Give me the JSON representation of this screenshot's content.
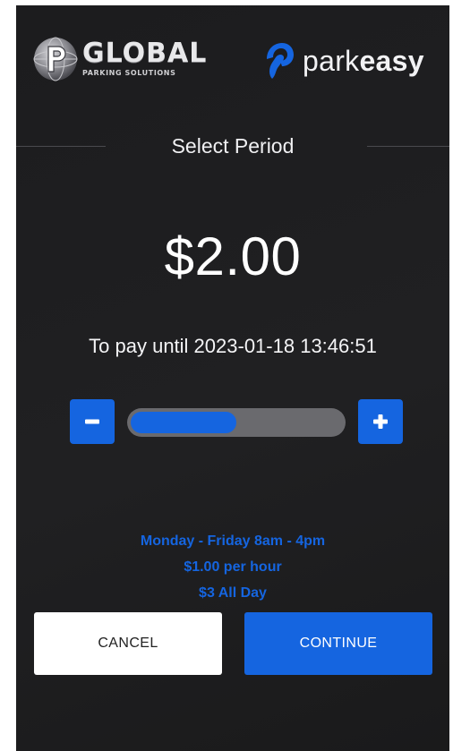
{
  "branding": {
    "operator_name": "GLOBAL",
    "operator_tagline": "PARKING SOLUTIONS",
    "operator_logo_icon": "globe-p-icon",
    "app_name_regular": "park",
    "app_name_bold": "easy",
    "app_logo_icon": "parkeasy-p-icon"
  },
  "period": {
    "title": "Select Period",
    "price": "$2.00",
    "pay_until": "To pay until 2023-01-18 13:46:51",
    "slider_fill_fraction": 0.5,
    "decrement_icon": "minus-icon",
    "increment_icon": "plus-icon"
  },
  "rates": {
    "lines": [
      "Monday - Friday 8am - 4pm",
      "$1.00 per hour",
      "$3 All Day"
    ]
  },
  "actions": {
    "cancel_label": "CANCEL",
    "continue_label": "CONTINUE"
  },
  "colors": {
    "accent": "#1565e0",
    "background": "#1e1e20",
    "slider_track": "#6a6a6e"
  }
}
